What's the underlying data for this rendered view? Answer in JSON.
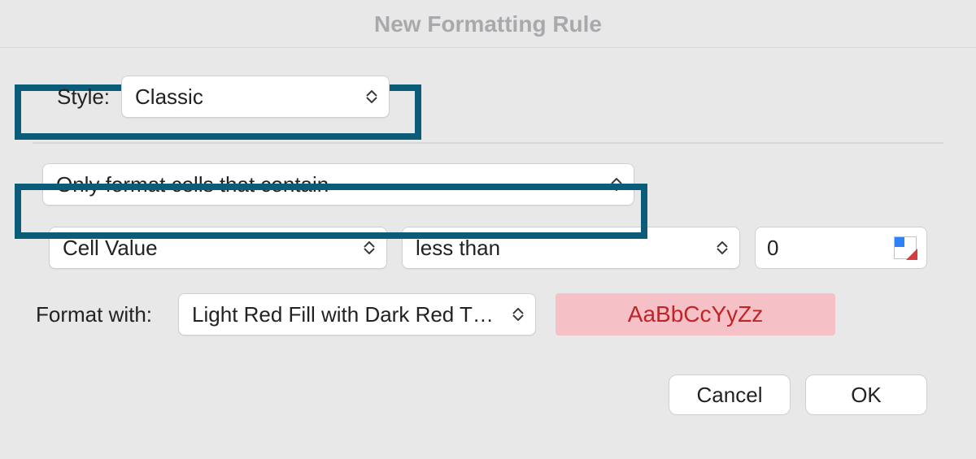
{
  "title": "New Formatting Rule",
  "style": {
    "label": "Style:",
    "selected": "Classic"
  },
  "rule_type": {
    "selected": "Only format cells that contain"
  },
  "condition": {
    "field": "Cell Value",
    "operator": "less than",
    "value": "0"
  },
  "format": {
    "label": "Format with:",
    "selected": "Light Red Fill with Dark Red T…",
    "preview_text": "AaBbCcYyZz",
    "preview_fill": "#f5c1c6",
    "preview_text_color": "#c02427"
  },
  "buttons": {
    "cancel": "Cancel",
    "ok": "OK"
  }
}
